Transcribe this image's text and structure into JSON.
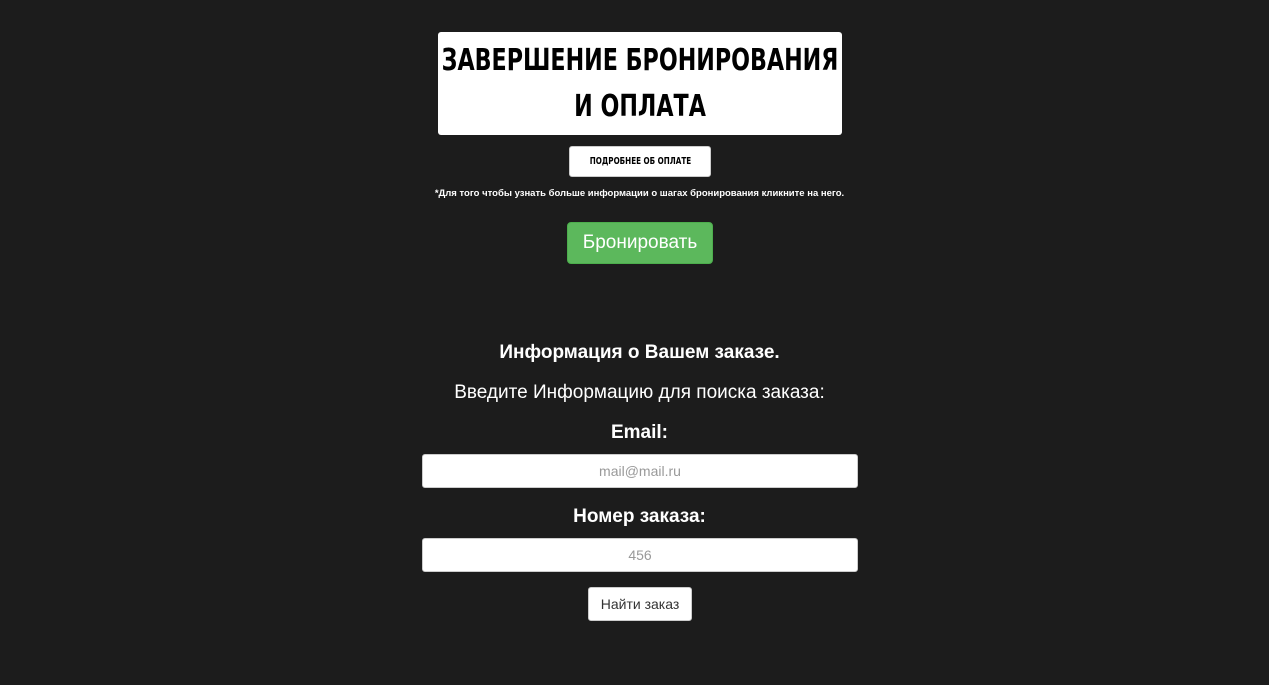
{
  "header": {
    "title_line1": "ЗАВЕРШЕНИЕ БРОНИРОВАНИЯ",
    "title_line2": "И ОПЛАТА"
  },
  "payment": {
    "details_button_label": "ПОДРОБНЕЕ ОБ ОПЛАТЕ",
    "note": "*Для того чтобы узнать больше информации о шагах бронирования кликните на него.",
    "book_button_label": "Бронировать",
    "book_button_color": "#5cb85c"
  },
  "order_lookup": {
    "heading": "Информация о Вашем заказе.",
    "subheading": "Введите Информацию для поиска заказа:",
    "email_label": "Email:",
    "email_placeholder": "mail@mail.ru",
    "email_value": "",
    "order_label": "Номер заказа:",
    "order_placeholder": "456",
    "order_value": "",
    "find_button_label": "Найти заказ"
  },
  "theme": {
    "background": "#1c1c1c",
    "text": "#ffffff"
  }
}
